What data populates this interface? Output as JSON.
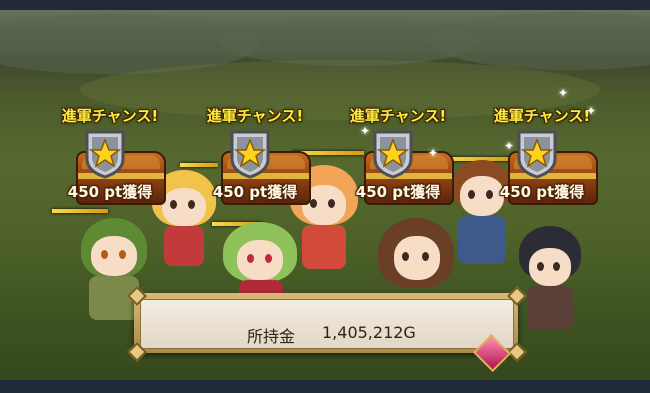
{
  "bonuses": [
    {
      "title": "進軍チャンス!",
      "points": "450 pt獲得",
      "icon": "star-shield-icon"
    },
    {
      "title": "進軍チャンス!",
      "points": "450 pt獲得",
      "icon": "star-shield-icon"
    },
    {
      "title": "進軍チャンス!",
      "points": "450 pt獲得",
      "icon": "star-shield-icon"
    },
    {
      "title": "進軍チャンス!",
      "points": "450 pt獲得",
      "icon": "star-shield-icon"
    }
  ],
  "gold": {
    "label": "所持金",
    "value": "1,405,212G"
  },
  "colors": {
    "title": "#ffec3a",
    "grass": "#4e6229",
    "panel": "#e2d7c7",
    "frame": "#20293a"
  }
}
